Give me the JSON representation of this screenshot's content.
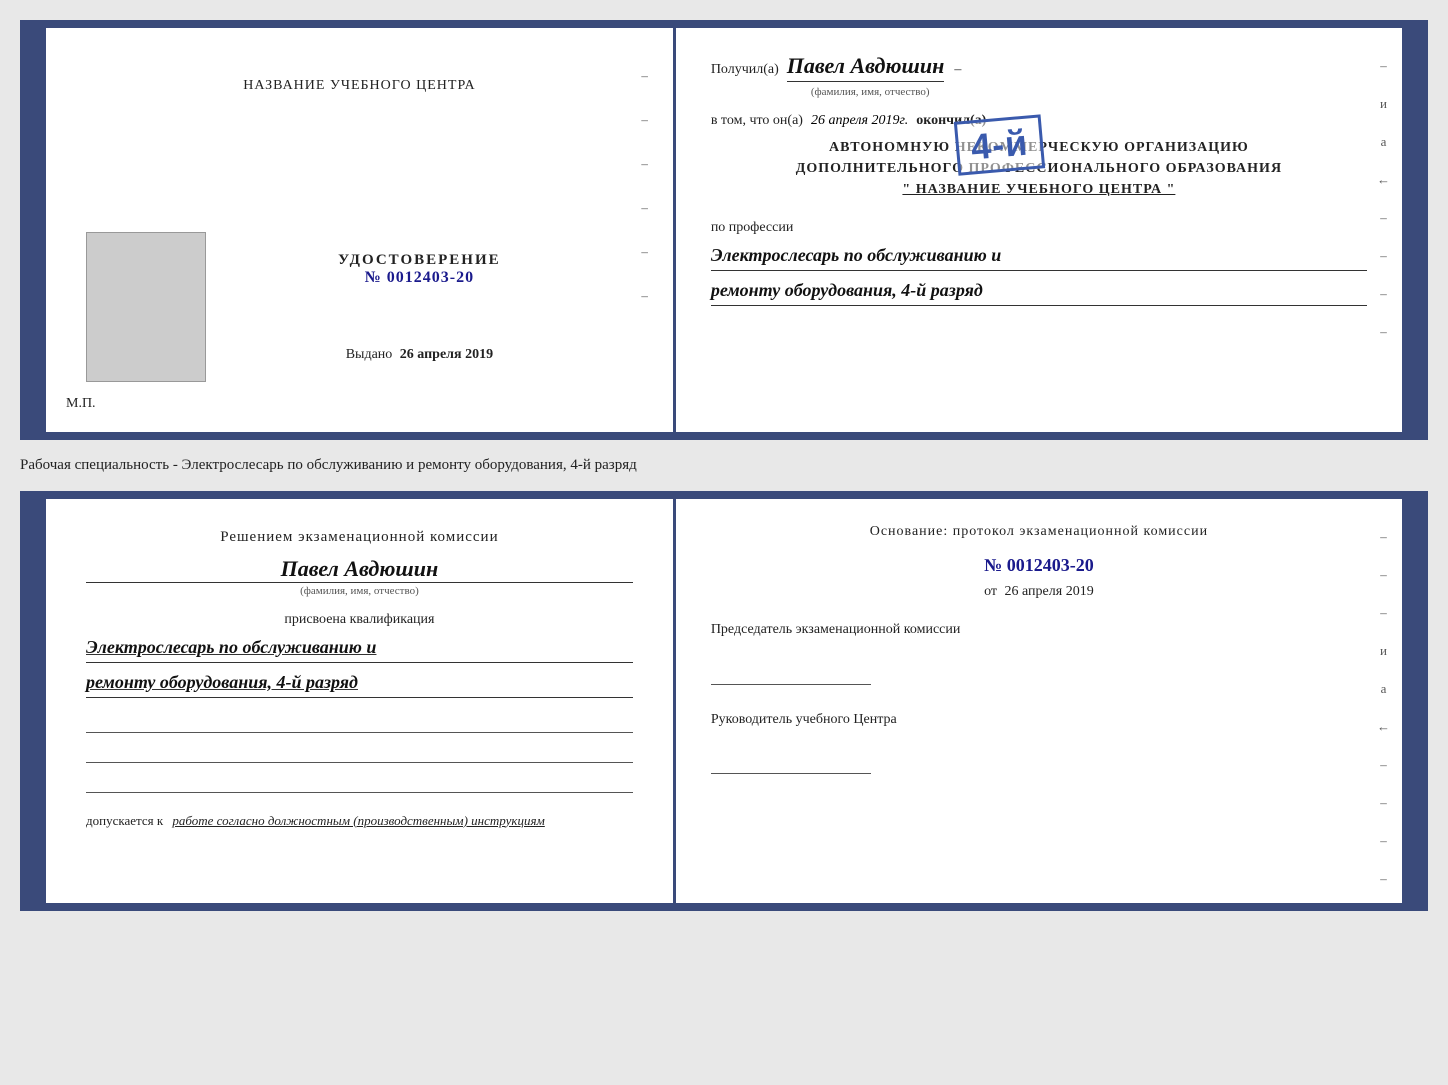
{
  "top_left": {
    "title": "НАЗВАНИЕ УЧЕБНОГО ЦЕНТРА",
    "cert_label": "УДОСТОВЕРЕНИЕ",
    "cert_number": "№ 0012403-20",
    "issued_prefix": "Выдано",
    "issued_date": "26 апреля 2019",
    "mp_label": "М.П."
  },
  "top_right": {
    "received_prefix": "Получил(а)",
    "received_name": "Павел Авдюшин",
    "name_subtitle": "(фамилия, имя, отчество)",
    "in_that_prefix": "в том, что он(а)",
    "in_that_date": "26 апреля 2019г.",
    "finished_label": "окончил(а)",
    "stamp_grade": "4-й",
    "stamp_line1": "АВТОНОМНУЮ НЕКОММЕРЧЕСКУЮ ОРГАНИЗАЦИЮ",
    "stamp_line2": "ДОПОЛНИТЕЛЬНОГО ПРОФЕССИОНАЛЬНОГО ОБРАЗОВАНИЯ",
    "stamp_line3": "\" НАЗВАНИЕ УЧЕБНОГО ЦЕНТРА \"",
    "profession_prefix": "по профессии",
    "profession_text": "Электрослесарь по обслуживанию и",
    "profession_text2": "ремонту оборудования, 4-й разряд"
  },
  "middle_label": "Рабочая специальность - Электрослесарь по обслуживанию и ремонту оборудования, 4-й разряд",
  "bottom_left": {
    "decision_title": "Решением экзаменационной комиссии",
    "person_name": "Павел Авдюшин",
    "name_subtitle": "(фамилия, имя, отчество)",
    "qualification_label": "присвоена квалификация",
    "qualification_text": "Электрослесарь по обслуживанию и",
    "qualification_text2": "ремонту оборудования, 4-й разряд",
    "allowed_prefix": "допускается к",
    "allowed_text": "работе согласно должностным (производственным) инструкциям"
  },
  "bottom_right": {
    "basis_title": "Основание: протокол экзаменационной  комиссии",
    "basis_number": "№  0012403-20",
    "from_prefix": "от",
    "from_date": "26 апреля 2019",
    "chairman_title": "Председатель экзаменационной комиссии",
    "director_title": "Руководитель учебного Центра"
  },
  "side_chars": [
    "–",
    "и",
    "а",
    "←",
    "–",
    "–",
    "–",
    "–"
  ]
}
